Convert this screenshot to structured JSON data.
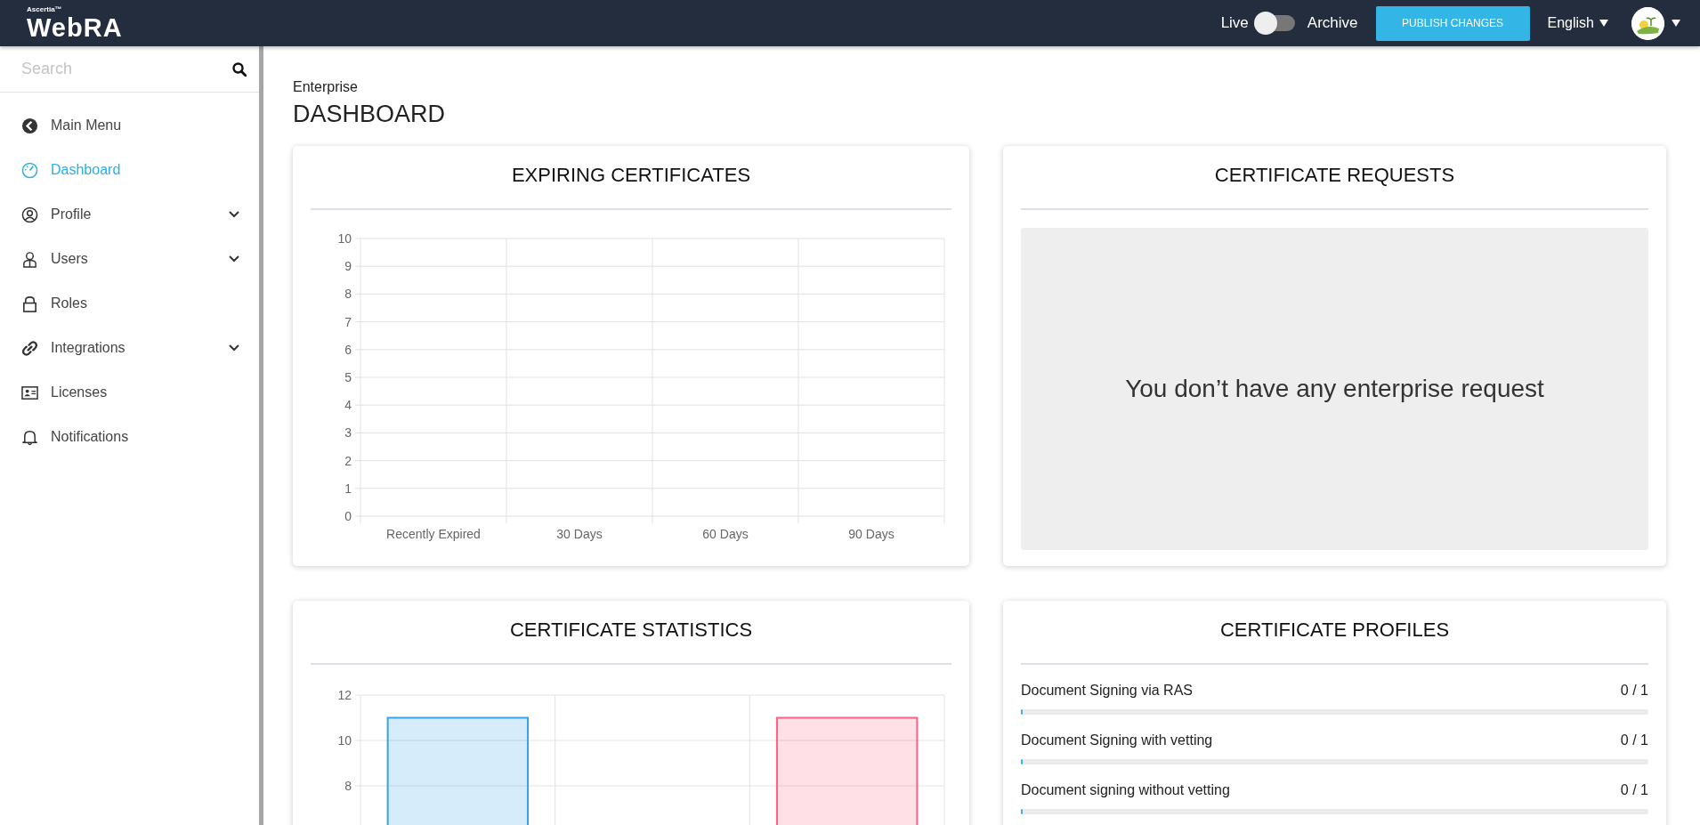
{
  "header": {
    "brand": {
      "company": "Ascertia™",
      "product": "WebRA"
    },
    "mode_toggle": {
      "left_label": "Live",
      "right_label": "Archive",
      "on": false
    },
    "publish_button": "PUBLISH CHANGES",
    "language": "English"
  },
  "sidebar": {
    "search": {
      "placeholder": "Search"
    },
    "items": [
      {
        "label": "Main Menu",
        "kind": "back",
        "selected": false
      },
      {
        "label": "Dashboard",
        "kind": "link",
        "selected": true
      },
      {
        "label": "Profile",
        "kind": "group",
        "selected": false,
        "expanded": false
      },
      {
        "label": "Users",
        "kind": "group",
        "selected": false,
        "expanded": false
      },
      {
        "label": "Roles",
        "kind": "link",
        "selected": false
      },
      {
        "label": "Integrations",
        "kind": "group",
        "selected": false,
        "expanded": false
      },
      {
        "label": "Licenses",
        "kind": "link",
        "selected": false
      },
      {
        "label": "Notifications",
        "kind": "link",
        "selected": false
      }
    ]
  },
  "page": {
    "breadcrumb": "Enterprise",
    "title": "DASHBOARD"
  },
  "cards": [
    {
      "kind": "chart",
      "title": "EXPIRING CERTIFICATES",
      "chart_data": {
        "type": "bar",
        "categories": [
          "Recently Expired",
          "30 Days",
          "60 Days",
          "90 Days"
        ],
        "values": [
          0,
          0,
          0,
          0
        ],
        "grid": true,
        "ylim": [
          0,
          10
        ],
        "yticks": [
          0,
          1,
          2,
          3,
          4,
          5,
          6,
          7,
          8,
          9,
          10
        ]
      }
    },
    {
      "kind": "empty",
      "title": "CERTIFICATE REQUESTS",
      "message": "You don’t have any enterprise request"
    },
    {
      "kind": "chart",
      "title": "CERTIFICATE STATISTICS",
      "chart_data": {
        "type": "bar",
        "values": [
          11,
          0,
          11
        ],
        "colors": [
          "#36a2eb",
          null,
          "#ff6384"
        ],
        "grid": true,
        "ylim": [
          0,
          12
        ],
        "yticks": [
          8,
          10,
          12
        ]
      }
    },
    {
      "kind": "list",
      "title": "CERTIFICATE PROFILES",
      "rows": [
        {
          "name": "Document Signing via RAS",
          "count": "0 / 1",
          "level": 0
        },
        {
          "name": "Document Signing with vetting",
          "count": "0 / 1",
          "level": 0
        },
        {
          "name": "Document signing without vetting",
          "count": "0 / 1",
          "level": 0
        }
      ]
    }
  ]
}
